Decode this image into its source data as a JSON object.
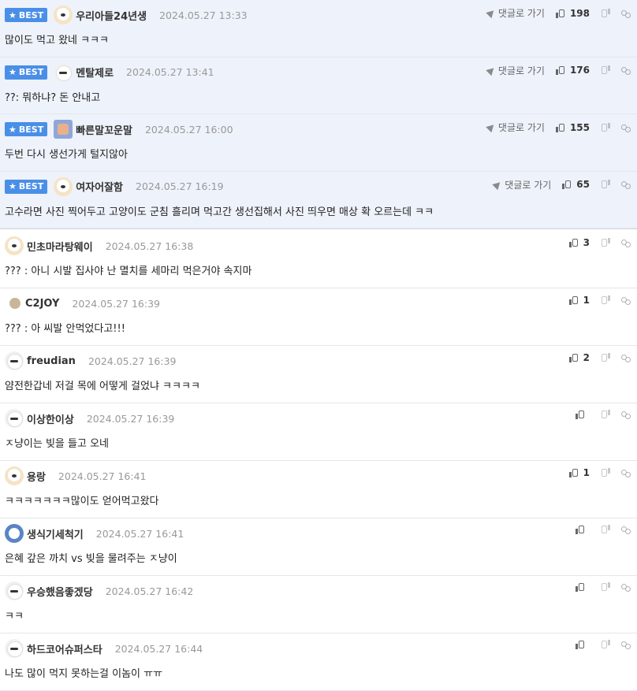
{
  "best_label": "BEST",
  "goto_label": "댓글로 가기",
  "best_comments": [
    {
      "nick": "우리아들24년생",
      "date": "2024.05.27 13:33",
      "text": "많이도 먹고 왔네 ㅋㅋㅋ",
      "up": "198",
      "avatar": "dog-icon"
    },
    {
      "nick": "멘탈제로",
      "date": "2024.05.27 13:41",
      "text": "??: 뭐하냐? 돈 안내고",
      "up": "176",
      "avatar": "puppy-icon"
    },
    {
      "nick": "빠른말꼬운말",
      "date": "2024.05.27 16:00",
      "text": "두번 다시 생선가게 털지않아",
      "up": "155",
      "avatar": "mixed-avatar-icon"
    },
    {
      "nick": "여자어잘함",
      "date": "2024.05.27 16:19",
      "text": "고수라면 사진 찍어두고 고양이도 군침 흘리며 먹고간 생선집해서 사진 띄우면 매상 확 오르는데 ㅋㅋ",
      "up": "65",
      "avatar": "dog-icon"
    }
  ],
  "comments": [
    {
      "nick": "민초마라탕웨이",
      "date": "2024.05.27 16:38",
      "text": "??? : 아니 시발 집사야 난 멸치를 세마리 먹은거야 속지마",
      "up": "3"
    },
    {
      "nick": "C2JOY",
      "date": "2024.05.27 16:39",
      "text": "??? : 아 씨발 안먹었다고!!!",
      "up": "1"
    },
    {
      "nick": "freudian",
      "date": "2024.05.27 16:39",
      "text": "얌전한갑네 저걸 목에 어떻게 걸었냐 ㅋㅋㅋㅋ",
      "up": "2"
    },
    {
      "nick": "이상한이상",
      "date": "2024.05.27 16:39",
      "text": "ㅈ냥이는 빚을 들고 오네",
      "up": ""
    },
    {
      "nick": "용랑",
      "date": "2024.05.27 16:41",
      "text": "ㅋㅋㅋㅋㅋㅋㅋ많이도 얻어먹고왔다",
      "up": "1"
    },
    {
      "nick": "생식기세척기",
      "date": "2024.05.27 16:41",
      "text": "은혜 갚은 까치 vs 빚을 물려주는 ㅈ냥이",
      "up": ""
    },
    {
      "nick": "우승했음좋겠당",
      "date": "2024.05.27 16:42",
      "text": "ㅋㅋ",
      "up": ""
    },
    {
      "nick": "하드코어슈퍼스타",
      "date": "2024.05.27 16:44",
      "text": "나도 많이 먹지 못하는걸 이놈이 ㅠㅠ",
      "up": ""
    }
  ]
}
